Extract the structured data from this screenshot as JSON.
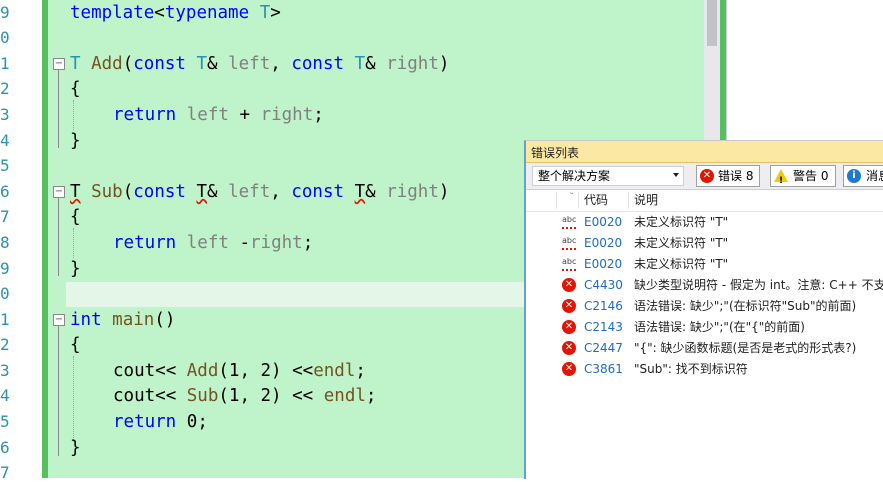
{
  "editor": {
    "line_numbers": [
      "9",
      "0",
      "1",
      "2",
      "3",
      "4",
      "5",
      "6",
      "7",
      "8",
      "9",
      "0",
      "1",
      "2",
      "3",
      "4",
      "5",
      "6",
      "7"
    ],
    "lines": [
      {
        "template": "template",
        "typename": "typename",
        "T": "T"
      },
      {},
      {
        "T": "T",
        "fn": "Add",
        "const": "const",
        "left": "left",
        "right": "right"
      },
      {
        "text": "{"
      },
      {
        "return": "return",
        "left": "left",
        "op": "+",
        "right": "right"
      },
      {
        "text": "}"
      },
      {},
      {
        "T": "T",
        "fn": "Sub",
        "const": "const",
        "left": "left",
        "right": "right"
      },
      {
        "text": "{"
      },
      {
        "return": "return",
        "left": "left",
        "op": "-",
        "right": "right"
      },
      {
        "text": "}"
      },
      {},
      {
        "int": "int",
        "fn": "main"
      },
      {
        "text": "{"
      },
      {
        "cout": "cout",
        "fn": "Add",
        "args": "(1, 2)",
        "endl": "endl"
      },
      {
        "cout": "cout",
        "fn": "Sub",
        "args": "(1, 2)",
        "endl": "endl"
      },
      {
        "return": "return",
        "zero": "0"
      },
      {
        "text": "}"
      }
    ]
  },
  "error_list": {
    "title": "错误列表",
    "scope": "整个解决方案",
    "errors_btn": "错误 8",
    "warnings_btn": "警告 0",
    "messages_btn": "消息",
    "col_code": "代码",
    "col_desc": "说明",
    "rows": [
      {
        "icon": "spell-squiggle-icon",
        "code": "E0020",
        "desc": "未定义标识符 \"T\""
      },
      {
        "icon": "spell-squiggle-icon",
        "code": "E0020",
        "desc": "未定义标识符 \"T\""
      },
      {
        "icon": "spell-squiggle-icon",
        "code": "E0020",
        "desc": "未定义标识符 \"T\""
      },
      {
        "icon": "error-icon",
        "code": "C4430",
        "desc": "缺少类型说明符 - 假定为 int。注意: C++ 不支"
      },
      {
        "icon": "error-icon",
        "code": "C2146",
        "desc": "语法错误: 缺少\";\"(在标识符\"Sub\"的前面)"
      },
      {
        "icon": "error-icon",
        "code": "C2143",
        "desc": "语法错误: 缺少\";\"(在\"{\"的前面)"
      },
      {
        "icon": "error-icon",
        "code": "C2447",
        "desc": "\"{\": 缺少函数标题(是否是老式的形式表?)"
      },
      {
        "icon": "error-icon",
        "code": "C3861",
        "desc": "\"Sub\": 找不到标识符"
      }
    ]
  },
  "colors": {
    "keyword": "#0000ff",
    "type": "#2b91af",
    "function": "#74531f",
    "param": "#808080",
    "error": "#e51400",
    "background": "#bff3c9"
  }
}
